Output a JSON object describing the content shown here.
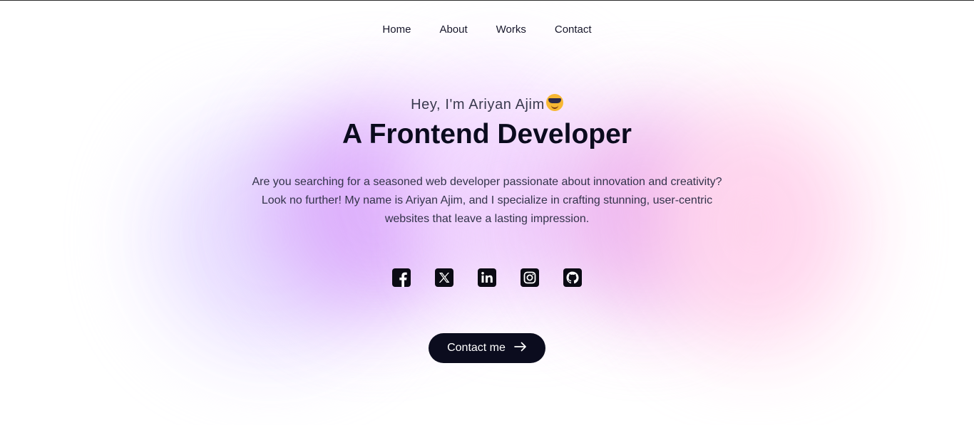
{
  "nav": {
    "items": [
      "Home",
      "About",
      "Works",
      "Contact"
    ]
  },
  "hero": {
    "greeting": "Hey, I'm Ariyan Ajim",
    "greeting_emoji": "smiling-face-with-sunglasses",
    "title": "A Frontend Developer",
    "description": "Are you searching for a seasoned web developer passionate about innovation and creativity? Look no further! My name is Ariyan Ajim, and I specialize in crafting stunning, user-centric websites that leave a lasting impression."
  },
  "social": [
    "facebook-icon",
    "x-twitter-icon",
    "linkedin-icon",
    "instagram-icon",
    "github-icon"
  ],
  "cta": {
    "label": "Contact me",
    "icon": "arrow-right-icon"
  },
  "colors": {
    "text_dark": "#0b0b1e",
    "button_bg": "#0b0c1e",
    "blob_lavender": "#e6dcff",
    "blob_purple": "#d9a3fb",
    "blob_pink": "#ffd3ec"
  }
}
